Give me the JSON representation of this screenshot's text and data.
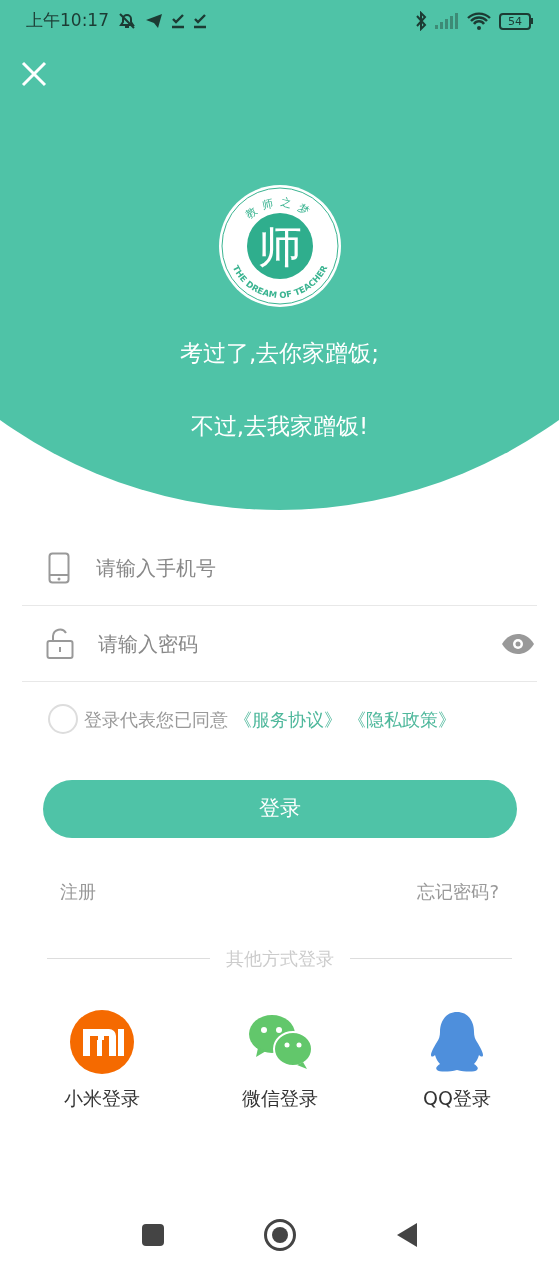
{
  "status_bar": {
    "time": "上午10:17",
    "battery": "54"
  },
  "header": {
    "logo": {
      "character": "师",
      "top_arc": "教师之梦",
      "bottom_arc": "THE DREAM OF TEACHER"
    },
    "slogan": [
      "考过了,去你家蹭饭;",
      "不过,去我家蹭饭!"
    ]
  },
  "form": {
    "phone": {
      "placeholder": "请输入手机号"
    },
    "password": {
      "placeholder": "请输入密码"
    },
    "agreement": {
      "checked": false,
      "text": "登录代表您已同意",
      "links": [
        "《服务协议》",
        "《隐私政策》"
      ]
    },
    "login_button": "登录",
    "register_link": "注册",
    "forgot_link": "忘记密码?"
  },
  "other_login": {
    "title": "其他方式登录",
    "options": [
      {
        "kind": "xiaomi",
        "label": "小米登录"
      },
      {
        "kind": "wechat",
        "label": "微信登录"
      },
      {
        "kind": "qq",
        "label": "QQ登录"
      }
    ]
  }
}
